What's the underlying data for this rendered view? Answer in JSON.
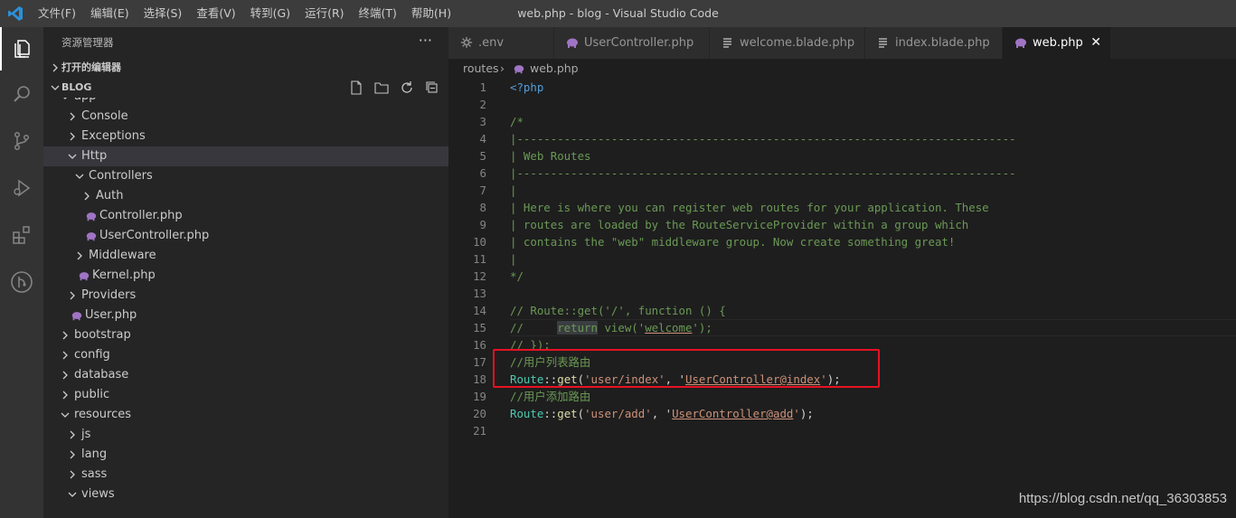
{
  "window": {
    "title": "web.php - blog - Visual Studio Code"
  },
  "menu": [
    "文件(F)",
    "编辑(E)",
    "选择(S)",
    "查看(V)",
    "转到(G)",
    "运行(R)",
    "终端(T)",
    "帮助(H)"
  ],
  "activity_bar": [
    {
      "name": "explorer-icon"
    },
    {
      "name": "search-icon"
    },
    {
      "name": "source-control-icon"
    },
    {
      "name": "run-debug-icon"
    },
    {
      "name": "extensions-icon"
    },
    {
      "name": "git-graph-icon"
    }
  ],
  "sidebar": {
    "title": "资源管理器",
    "more": "···",
    "open_editors": "打开的编辑器",
    "project": "BLOG",
    "project_actions": [
      "new-file-icon",
      "new-folder-icon",
      "refresh-icon",
      "collapse-all-icon"
    ],
    "tree": [
      {
        "label": "app",
        "type": "folder",
        "open": true,
        "indent": 0
      },
      {
        "label": "Console",
        "type": "folder",
        "open": false,
        "indent": 1
      },
      {
        "label": "Exceptions",
        "type": "folder",
        "open": false,
        "indent": 1
      },
      {
        "label": "Http",
        "type": "folder",
        "open": true,
        "indent": 1
      },
      {
        "label": "Controllers",
        "type": "folder",
        "open": true,
        "indent": 2
      },
      {
        "label": "Auth",
        "type": "folder",
        "open": false,
        "indent": 3
      },
      {
        "label": "Controller.php",
        "type": "php",
        "indent": 3
      },
      {
        "label": "UserController.php",
        "type": "php",
        "indent": 3
      },
      {
        "label": "Middleware",
        "type": "folder",
        "open": false,
        "indent": 2
      },
      {
        "label": "Kernel.php",
        "type": "php",
        "indent": 2
      },
      {
        "label": "Providers",
        "type": "folder",
        "open": false,
        "indent": 1
      },
      {
        "label": "User.php",
        "type": "php",
        "indent": 1
      },
      {
        "label": "bootstrap",
        "type": "folder",
        "open": false,
        "indent": 0
      },
      {
        "label": "config",
        "type": "folder",
        "open": false,
        "indent": 0
      },
      {
        "label": "database",
        "type": "folder",
        "open": false,
        "indent": 0
      },
      {
        "label": "public",
        "type": "folder",
        "open": false,
        "indent": 0
      },
      {
        "label": "resources",
        "type": "folder",
        "open": true,
        "indent": 0
      },
      {
        "label": "js",
        "type": "folder",
        "open": false,
        "indent": 1
      },
      {
        "label": "lang",
        "type": "folder",
        "open": false,
        "indent": 1
      },
      {
        "label": "sass",
        "type": "folder",
        "open": false,
        "indent": 1
      },
      {
        "label": "views",
        "type": "folder",
        "open": true,
        "indent": 1
      }
    ],
    "selected_item": "Http"
  },
  "tabs": [
    {
      "label": ".env",
      "icon": "gear-icon",
      "active": false
    },
    {
      "label": "UserController.php",
      "icon": "php-elephant-icon",
      "active": false
    },
    {
      "label": "welcome.blade.php",
      "icon": "lines-icon",
      "active": false
    },
    {
      "label": "index.blade.php",
      "icon": "lines-icon",
      "active": false
    },
    {
      "label": "web.php",
      "icon": "php-elephant-icon",
      "active": true,
      "close": "✕"
    }
  ],
  "breadcrumb": {
    "folder": "routes",
    "separator": "›",
    "file": "web.php"
  },
  "code": [
    {
      "n": "1",
      "t": [
        {
          "s": "<?php",
          "c": "tag"
        }
      ]
    },
    {
      "n": "2",
      "t": []
    },
    {
      "n": "3",
      "t": [
        {
          "s": "/*",
          "c": "cm"
        }
      ]
    },
    {
      "n": "4",
      "t": [
        {
          "s": "|--------------------------------------------------------------------------",
          "c": "cm"
        }
      ]
    },
    {
      "n": "5",
      "t": [
        {
          "s": "| Web Routes",
          "c": "cm"
        }
      ]
    },
    {
      "n": "6",
      "t": [
        {
          "s": "|--------------------------------------------------------------------------",
          "c": "cm"
        }
      ]
    },
    {
      "n": "7",
      "t": [
        {
          "s": "|",
          "c": "cm"
        }
      ]
    },
    {
      "n": "8",
      "t": [
        {
          "s": "| Here is where you can register web routes for your application. These",
          "c": "cm"
        }
      ]
    },
    {
      "n": "9",
      "t": [
        {
          "s": "| routes are loaded by the RouteServiceProvider within a group which",
          "c": "cm"
        }
      ]
    },
    {
      "n": "10",
      "t": [
        {
          "s": "| contains the \"web\" middleware group. Now create something great!",
          "c": "cm"
        }
      ]
    },
    {
      "n": "11",
      "t": [
        {
          "s": "|",
          "c": "cm"
        }
      ]
    },
    {
      "n": "12",
      "t": [
        {
          "s": "*/",
          "c": "cm"
        }
      ]
    },
    {
      "n": "13",
      "t": []
    },
    {
      "n": "14",
      "t": [
        {
          "s": "// Route::get('/', function () {",
          "c": "cm"
        }
      ]
    },
    {
      "n": "15",
      "t": [
        {
          "s": "//     ",
          "c": "cm"
        },
        {
          "s": "return",
          "c": "cm kwbox"
        },
        {
          "s": " view('",
          "c": "cm"
        },
        {
          "s": "welcome",
          "c": "cm uline"
        },
        {
          "s": "');",
          "c": "cm"
        }
      ]
    },
    {
      "n": "16",
      "t": [
        {
          "s": "// });",
          "c": "cm"
        }
      ]
    },
    {
      "n": "17",
      "t": [
        {
          "s": "//用户列表路由",
          "c": "cm"
        }
      ]
    },
    {
      "n": "18",
      "t": [
        {
          "s": "Route",
          "c": "cls"
        },
        {
          "s": "::",
          "c": "op"
        },
        {
          "s": "get",
          "c": "fn"
        },
        {
          "s": "(",
          "c": "op"
        },
        {
          "s": "'user/index'",
          "c": "str"
        },
        {
          "s": ", '",
          "c": "op"
        },
        {
          "s": "UserController@index",
          "c": "str uline"
        },
        {
          "s": "'",
          "c": "str"
        },
        {
          "s": ");",
          "c": "op"
        }
      ]
    },
    {
      "n": "19",
      "t": [
        {
          "s": "//用户添加路由",
          "c": "cm"
        }
      ]
    },
    {
      "n": "20",
      "t": [
        {
          "s": "Route",
          "c": "cls"
        },
        {
          "s": "::",
          "c": "op"
        },
        {
          "s": "get",
          "c": "fn"
        },
        {
          "s": "(",
          "c": "op"
        },
        {
          "s": "'user/add'",
          "c": "str"
        },
        {
          "s": ", '",
          "c": "op"
        },
        {
          "s": "UserController@add",
          "c": "str uline"
        },
        {
          "s": "'",
          "c": "str"
        },
        {
          "s": ");",
          "c": "op"
        }
      ]
    },
    {
      "n": "21",
      "t": []
    }
  ],
  "current_line": 15,
  "highlight_box_lines": [
    17,
    18
  ],
  "watermark": "https://blog.csdn.net/qq_36303853",
  "colors": {
    "accent": "#007acc",
    "php_icon": "#a074c4",
    "annotation": "#e81123"
  }
}
